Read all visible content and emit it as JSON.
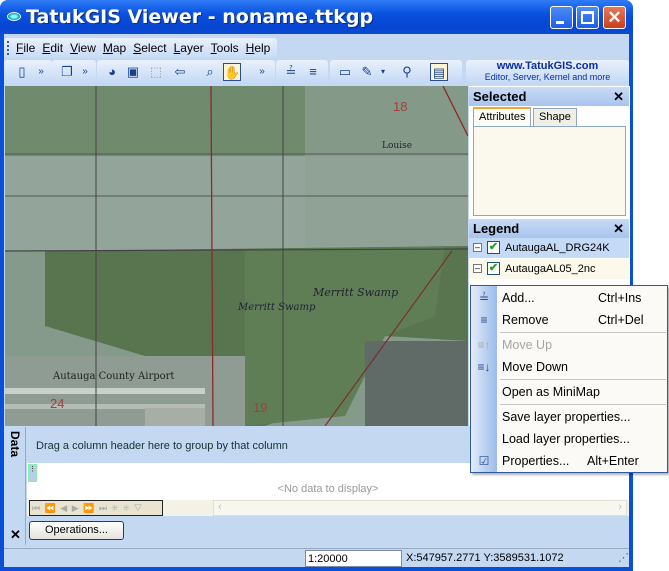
{
  "window": {
    "title": "TatukGIS Viewer - noname.ttkgp"
  },
  "menu": [
    "File",
    "Edit",
    "View",
    "Map",
    "Select",
    "Layer",
    "Tools",
    "Help"
  ],
  "brand": {
    "url": "www.TatukGIS.com",
    "tagline": "Editor, Server, Kernel and more"
  },
  "map": {
    "labels": {
      "airport": "Autauga County Airport",
      "swamp1": "Merritt Swamp",
      "swamp2": "Merritt Swamp",
      "town": "Louise",
      "sec19": "19",
      "sec24": "24",
      "sec18": "18"
    }
  },
  "selected_panel": {
    "title": "Selected",
    "tabs": [
      "Attributes",
      "Shape"
    ]
  },
  "legend_panel": {
    "title": "Legend",
    "layers": [
      {
        "name": "AutaugaAL_DRG24K",
        "checked": true
      },
      {
        "name": "AutaugaAL05_2nc",
        "checked": true
      }
    ]
  },
  "context_menu": [
    {
      "label": "Add...",
      "shortcut": "Ctrl+Ins",
      "icon": "add-layer-icon",
      "enabled": true
    },
    {
      "label": "Remove",
      "shortcut": "Ctrl+Del",
      "icon": "remove-layer-icon",
      "enabled": true
    },
    {
      "label": "Move Up",
      "shortcut": "",
      "icon": "move-up-icon",
      "enabled": false
    },
    {
      "label": "Move Down",
      "shortcut": "",
      "icon": "move-down-icon",
      "enabled": true
    },
    {
      "label": "Open as MiniMap",
      "shortcut": "",
      "enabled": true
    },
    {
      "label": "Save layer properties...",
      "shortcut": "",
      "enabled": true
    },
    {
      "label": "Load layer properties...",
      "shortcut": "",
      "enabled": true
    },
    {
      "label": "Properties...",
      "shortcut": "Alt+Enter",
      "icon": "properties-icon",
      "enabled": true
    }
  ],
  "data_panel": {
    "title": "Data",
    "group_hint": "Drag a column header here to group by that column",
    "empty_text": "<No data to display>",
    "operations_label": "Operations..."
  },
  "status": {
    "scale": "1:20000",
    "coords": "X:547957.2771  Y:3589531.1072"
  }
}
